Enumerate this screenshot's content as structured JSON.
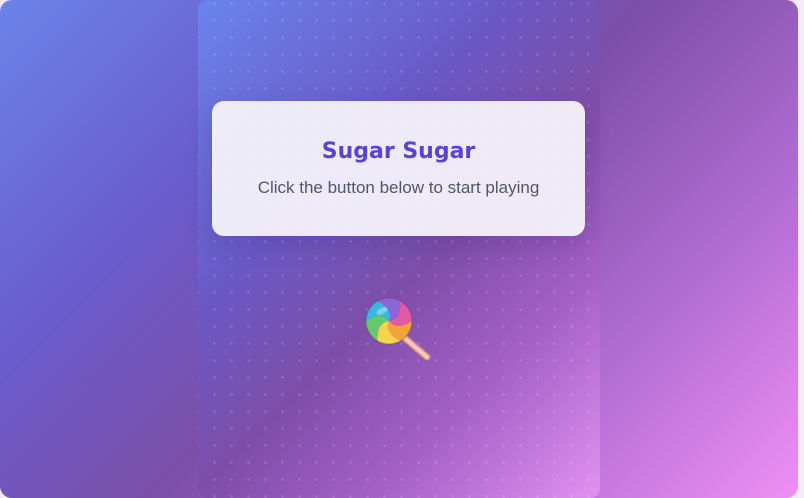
{
  "game": {
    "title": "Sugar Sugar",
    "instructions": "Click the button below to start playing"
  },
  "start_button": {
    "icon": "lollipop-icon",
    "candy_colors": [
      "#f2a33a",
      "#f7d54a",
      "#66c96b",
      "#39b7e0",
      "#8a66d8",
      "#e05aa8"
    ],
    "stick_color": "#f4b6a0"
  },
  "colors": {
    "title": "#5744d6",
    "subtitle": "#50566a",
    "background_start": "#6b83ea",
    "background_end": "#ee90f3"
  }
}
